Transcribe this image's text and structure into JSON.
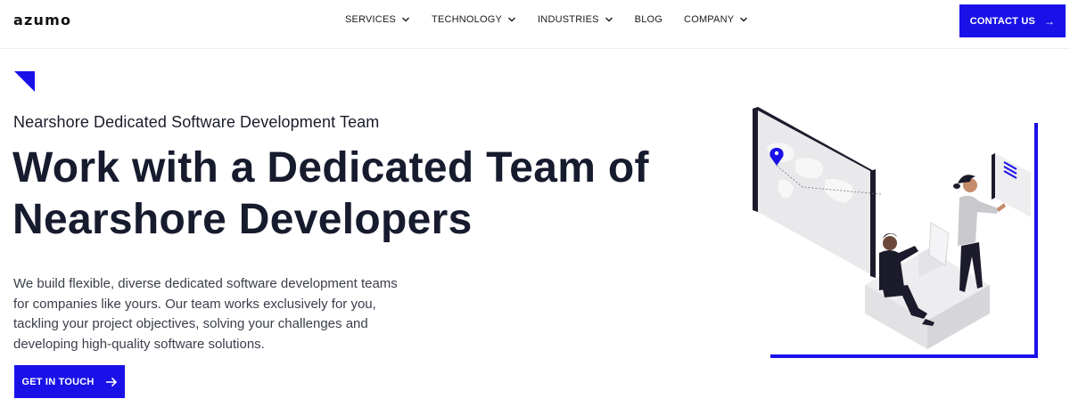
{
  "header": {
    "logo": "azumo",
    "nav": [
      {
        "label": "SERVICES",
        "has_dropdown": true
      },
      {
        "label": "TECHNOLOGY",
        "has_dropdown": true
      },
      {
        "label": "INDUSTRIES",
        "has_dropdown": true
      },
      {
        "label": "BLOG",
        "has_dropdown": false
      },
      {
        "label": "COMPANY",
        "has_dropdown": true
      }
    ],
    "contact_label": "CONTACT US",
    "contact_icon": "arrow-right-icon"
  },
  "hero": {
    "eyebrow": "Nearshore Dedicated Software Development Team",
    "headline_line1": "Work with a Dedicated Team of",
    "headline_line2": "Nearshore Developers",
    "description": "We build flexible, diverse dedicated software development teams for companies like yours. Our team works exclusively for you, tackling your project objectives, solving your challenges and developing high-quality software solutions.",
    "cta_label": "GET IN TOUCH",
    "cta_icon": "arrow-right-icon"
  },
  "colors": {
    "brand_blue": "#1a11e8",
    "text_dark": "#171b2e",
    "text_body": "#3b3e4a"
  }
}
